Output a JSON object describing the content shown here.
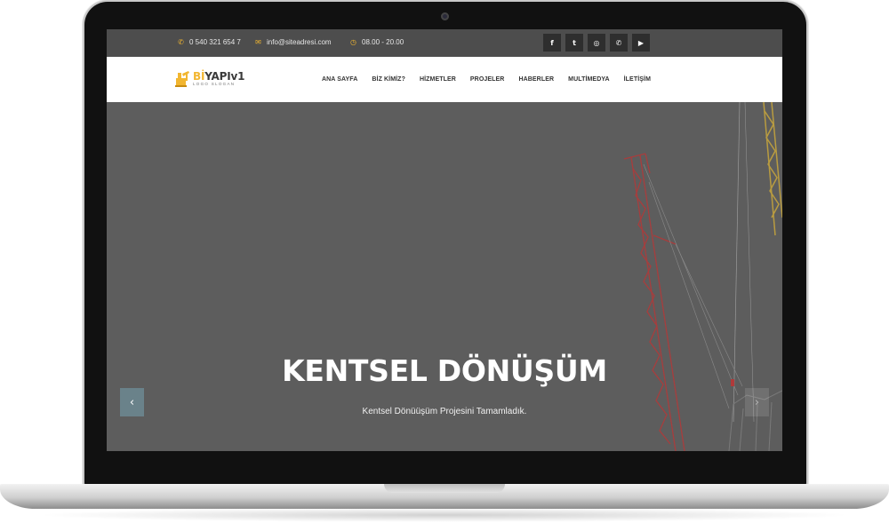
{
  "topbar": {
    "phone": "0 540 321 654 7",
    "email": "info@siteadresi.com",
    "hours": "08.00 - 20.00",
    "social": [
      {
        "name": "facebook-icon",
        "glyph": "f"
      },
      {
        "name": "twitter-icon",
        "glyph": "t"
      },
      {
        "name": "instagram-icon",
        "glyph": "◎"
      },
      {
        "name": "whatsapp-icon",
        "glyph": "✆"
      },
      {
        "name": "youtube-icon",
        "glyph": "▶"
      }
    ]
  },
  "logo": {
    "name_prefix": "Bİ",
    "name_suffix": "YAPIv1",
    "slogan": "LOGO SLOGAN"
  },
  "menu": [
    "ANA SAYFA",
    "BİZ KİMİZ?",
    "HİZMETLER",
    "PROJELER",
    "HABERLER",
    "MULTİMEDYA",
    "İLETİŞİM"
  ],
  "hero": {
    "title": "KENTSEL DÖNÜŞÜM",
    "subtitle": "Kentsel Dönüüşüm Projesini Tamamladık.",
    "prev_glyph": "‹",
    "next_glyph": "›"
  },
  "colors": {
    "accent": "#f2b630",
    "topbar_bg": "#4d4d4d",
    "hero_overlay": "#5d5d5d",
    "crane": "#b03a3a"
  }
}
